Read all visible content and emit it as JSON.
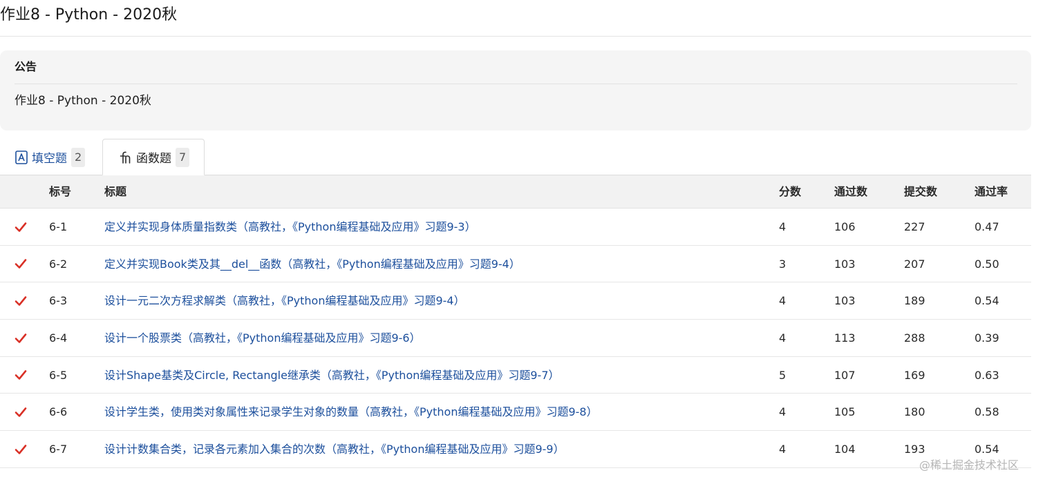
{
  "page": {
    "title": "作业8 - Python - 2020秋"
  },
  "notice": {
    "heading": "公告",
    "body": "作业8 - Python - 2020秋"
  },
  "tabs": [
    {
      "label": "填空题",
      "count": "2",
      "icon": "fill-blank-icon",
      "active": false
    },
    {
      "label": "函数题",
      "count": "7",
      "icon": "function-icon",
      "active": true
    }
  ],
  "table": {
    "headers": {
      "number": "标号",
      "title": "标题",
      "score": "分数",
      "passed": "通过数",
      "submitted": "提交数",
      "rate": "通过率"
    },
    "rows": [
      {
        "status": "check-icon",
        "number": "6-1",
        "title": "定义并实现身体质量指数类（高教社，《Python编程基础及应用》习题9-3）",
        "score": "4",
        "passed": "106",
        "submitted": "227",
        "rate": "0.47"
      },
      {
        "status": "check-icon",
        "number": "6-2",
        "title": "定义并实现Book类及其__del__函数（高教社，《Python编程基础及应用》习题9-4）",
        "score": "3",
        "passed": "103",
        "submitted": "207",
        "rate": "0.50"
      },
      {
        "status": "check-icon",
        "number": "6-3",
        "title": "设计一元二次方程求解类（高教社，《Python编程基础及应用》习题9-4）",
        "score": "4",
        "passed": "103",
        "submitted": "189",
        "rate": "0.54"
      },
      {
        "status": "check-icon",
        "number": "6-4",
        "title": "设计一个股票类（高教社，《Python编程基础及应用》习题9-6）",
        "score": "4",
        "passed": "113",
        "submitted": "288",
        "rate": "0.39"
      },
      {
        "status": "check-icon",
        "number": "6-5",
        "title": "设计Shape基类及Circle, Rectangle继承类（高教社，《Python编程基础及应用》习题9-7）",
        "score": "5",
        "passed": "107",
        "submitted": "169",
        "rate": "0.63"
      },
      {
        "status": "check-icon",
        "number": "6-6",
        "title": "设计学生类，使用类对象属性来记录学生对象的数量（高教社，《Python编程基础及应用》习题9-8）",
        "score": "4",
        "passed": "105",
        "submitted": "180",
        "rate": "0.58"
      },
      {
        "status": "check-icon",
        "number": "6-7",
        "title": "设计计数集合类，记录各元素加入集合的次数（高教社，《Python编程基础及应用》习题9-9）",
        "score": "4",
        "passed": "104",
        "submitted": "193",
        "rate": "0.54"
      }
    ]
  },
  "watermark": "@稀土掘金技术社区",
  "colors": {
    "link": "#1c4f9c",
    "check": "#d93026",
    "header_bg": "#f2f2f2",
    "notice_bg": "#f5f5f5"
  }
}
